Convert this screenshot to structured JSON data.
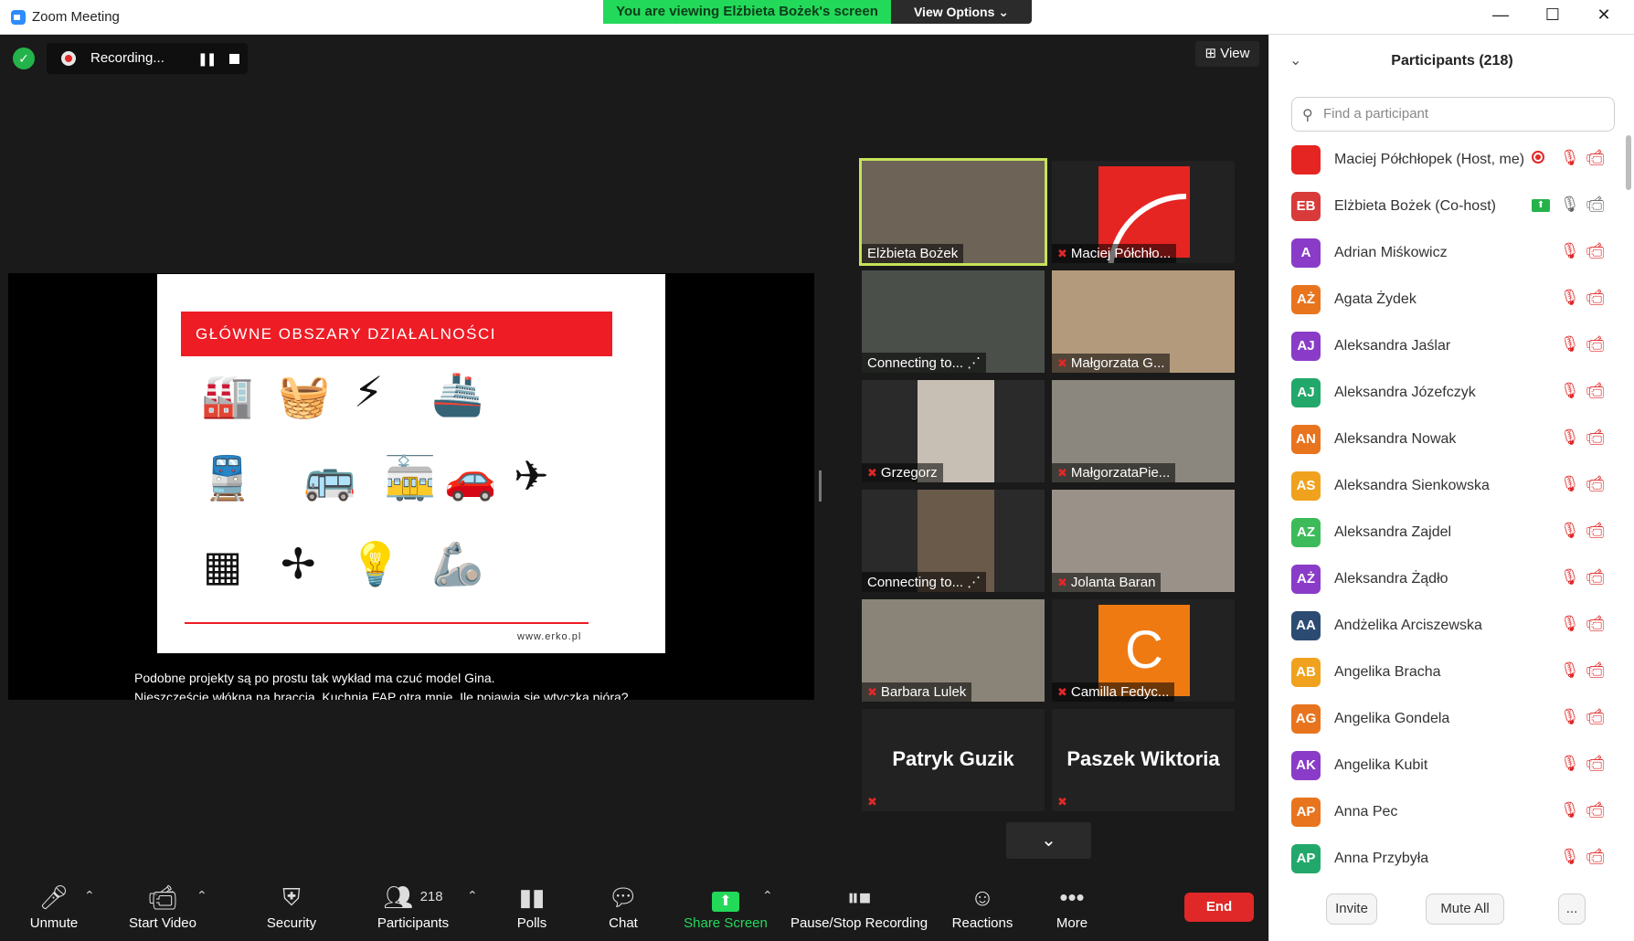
{
  "window": {
    "title": "Zoom Meeting",
    "minimize": "—",
    "maximize": "☐",
    "close": "✕"
  },
  "banner": {
    "text": "You are viewing Elżbieta Bożek's screen",
    "view_options": "View Options ⌄"
  },
  "recording": {
    "status": "Recording...",
    "pause": "❚❚"
  },
  "view_button": "⊞ View",
  "shared_slide": {
    "title": "GŁÓWNE OBSZARY DZIAŁALNOŚCI",
    "footer": "www.erko.pl",
    "icons": [
      "factory-icon",
      "washing-machine-icon",
      "transformer-icon",
      "ship-icon",
      "train-icon",
      "bus-icon",
      "tram-icon",
      "electric-car-icon",
      "airplane-icon",
      "solar-panel-icon",
      "wind-turbine-icon",
      "light-bulb-icon",
      "robot-arm-icon"
    ],
    "glyphs": [
      "🏭",
      "🧺",
      "⚡",
      "🚢",
      "🚆",
      "🚌",
      "🚋",
      "🚗",
      "✈",
      "▦",
      "✢",
      "💡",
      "🦾"
    ]
  },
  "caption": {
    "line1": "Podobne projekty są po prostu tak wykład ma czuć model Gina.",
    "line2": "Nieszczęście włókna na braccia. Kuchnia FAP otra mnie. Ile pojawia się wtyczka pióra?"
  },
  "gallery": [
    {
      "name": "Elżbieta Bożek",
      "muted": false
    },
    {
      "name": "Maciej Półchło...",
      "muted": true
    },
    {
      "name": "Connecting to... ⋰",
      "muted": false
    },
    {
      "name": "Małgorzata G...",
      "muted": true
    },
    {
      "name": "Grzegorz",
      "muted": true
    },
    {
      "name": "MałgorzataPie...",
      "muted": true
    },
    {
      "name": "Connecting to... ⋰",
      "muted": false
    },
    {
      "name": "Jolanta Baran",
      "muted": true
    },
    {
      "name": "Barbara Lulek",
      "muted": true
    },
    {
      "name": "Camilla Fedyc...",
      "muted": true,
      "letter": "C"
    },
    {
      "name": "Patryk Guzik",
      "muted": true
    },
    {
      "name": "Paszek Wiktoria",
      "muted": true
    }
  ],
  "gallery_page_down": "⌄",
  "toolbar": {
    "unmute": "Unmute",
    "start_video": "Start Video",
    "security": "Security",
    "participants": "Participants",
    "participants_count": "218",
    "polls": "Polls",
    "chat": "Chat",
    "share_screen": "Share Screen",
    "pause_stop_recording": "Pause/Stop Recording",
    "reactions": "Reactions",
    "more": "More",
    "end": "End"
  },
  "panel": {
    "title": "Participants (218)",
    "search_placeholder": "Find a participant",
    "participants": [
      {
        "initials": "",
        "name": "Maciej Półchłopek (Host, me)",
        "color": "#e52522",
        "logo": true,
        "recording": true
      },
      {
        "initials": "EB",
        "name": "Elżbieta Bożek (Co-host)",
        "color": "#d93b3b",
        "sharing": true,
        "mic_on": true,
        "cam_on": true
      },
      {
        "initials": "A",
        "name": "Adrian Miśkowicz",
        "color": "#8a3cc8"
      },
      {
        "initials": "AŻ",
        "name": "Agata Żydek",
        "color": "#e8741e"
      },
      {
        "initials": "AJ",
        "name": "Aleksandra Jaślar",
        "color": "#8a3cc8"
      },
      {
        "initials": "AJ",
        "name": "Aleksandra Józefczyk",
        "color": "#23a86b"
      },
      {
        "initials": "AN",
        "name": "Aleksandra Nowak",
        "color": "#e8741e"
      },
      {
        "initials": "AS",
        "name": "Aleksandra Sienkowska",
        "color": "#f0a21e"
      },
      {
        "initials": "AZ",
        "name": "Aleksandra Zajdel",
        "color": "#3dbb5a"
      },
      {
        "initials": "AŻ",
        "name": "Aleksandra Żądło",
        "color": "#8a3cc8"
      },
      {
        "initials": "AA",
        "name": "Andżelika Arciszewska",
        "color": "#2b4b72"
      },
      {
        "initials": "AB",
        "name": "Angelika Bracha",
        "color": "#f0a21e"
      },
      {
        "initials": "AG",
        "name": "Angelika Gondela",
        "color": "#e8741e"
      },
      {
        "initials": "AK",
        "name": "Angelika Kubit",
        "color": "#8a3cc8"
      },
      {
        "initials": "AP",
        "name": "Anna Pec",
        "color": "#e8741e"
      },
      {
        "initials": "AP",
        "name": "Anna Przybyła",
        "color": "#23a86b"
      }
    ],
    "invite": "Invite",
    "mute_all": "Mute All",
    "more": "..."
  },
  "colors": {
    "accent_green": "#23d959",
    "end_red": "#e02828",
    "slide_red": "#ee1c25",
    "active_speaker": "#c6e35a"
  }
}
